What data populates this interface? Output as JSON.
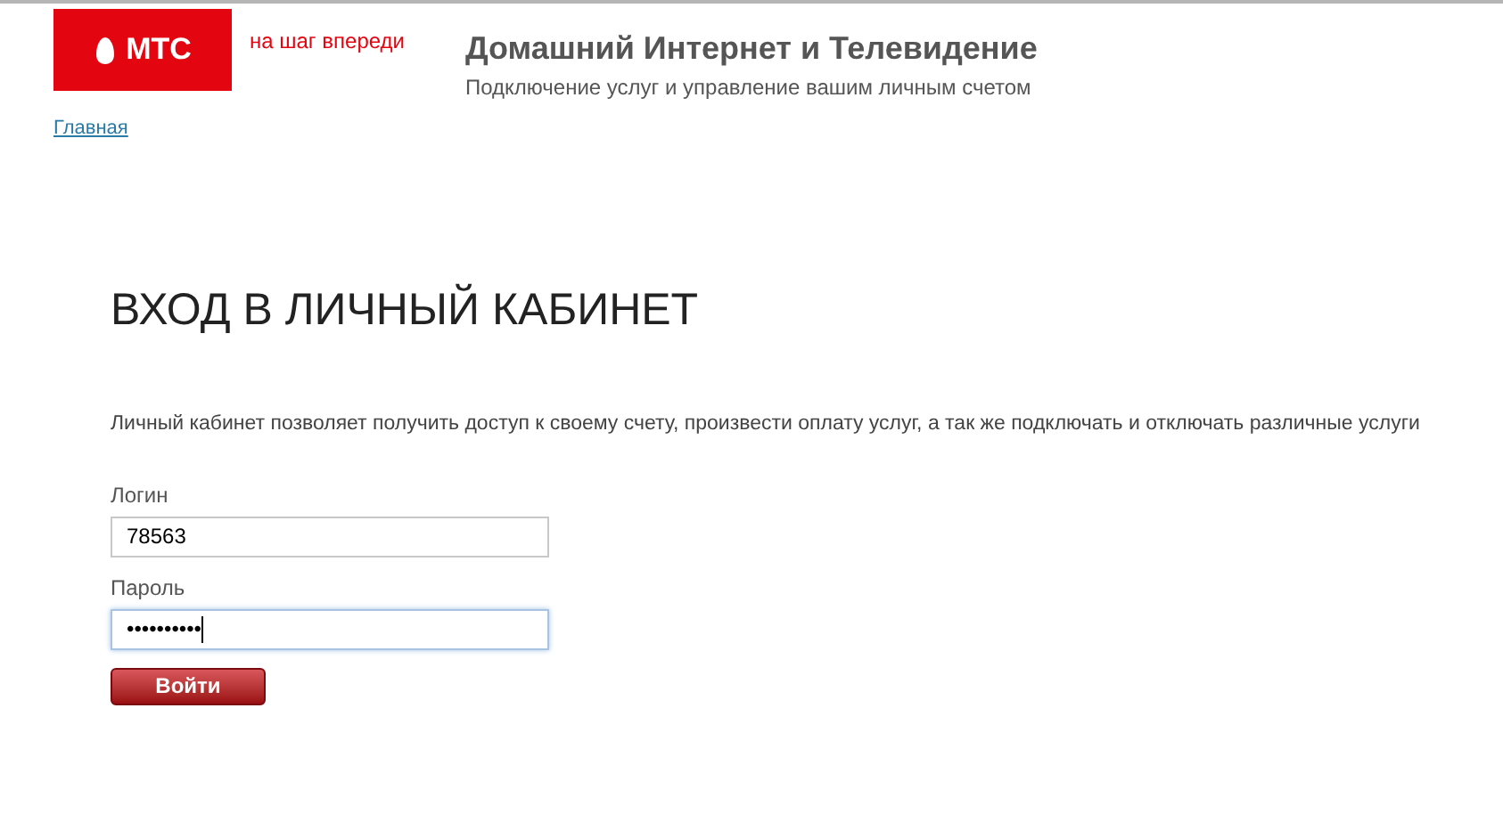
{
  "header": {
    "logo_text": "МТС",
    "tagline": "на шаг впереди",
    "title": "Домашний Интернет и Телевидение",
    "subtitle": "Подключение услуг и управление вашим личным счетом"
  },
  "breadcrumb": "Главная",
  "heading": "ВХОД В ЛИЧНЫЙ КАБИНЕТ",
  "description": "Личный кабинет позволяет получить доступ к своему счету, произвести оплату услуг, а так же подключать и отключать различные услуги",
  "fields": [
    {
      "label": "Логин",
      "value": "78563",
      "focused": false
    },
    {
      "label": "Пароль",
      "value": "••••••••••",
      "focused": true
    }
  ],
  "submit_button": "Войти"
}
